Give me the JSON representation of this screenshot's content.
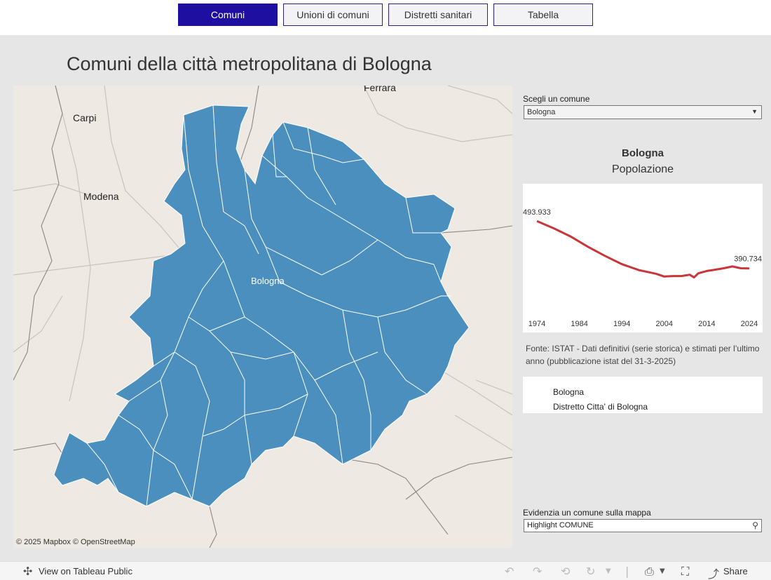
{
  "tabs": [
    "Comuni",
    "Unioni di comuni",
    "Distretti sanitari",
    "Tabella"
  ],
  "title": "Comuni della città metropolitana di Bologna",
  "map": {
    "labels": {
      "ferrara": "Ferrara",
      "carpi": "Carpi",
      "modena": "Modena",
      "bologna": "Bologna"
    },
    "attribution": "© 2025 Mapbox  © OpenStreetMap",
    "fill_color": "#4a8fbd",
    "background": "#efe9e3"
  },
  "selector": {
    "label": "Scegli un comune",
    "value": "Bologna"
  },
  "chart": {
    "name": "Bologna",
    "subtitle": "Popolazione",
    "first_label": "493.933",
    "last_label": "390.734"
  },
  "chart_data": {
    "type": "line",
    "title": "Popolazione",
    "x": [
      1974,
      1978,
      1982,
      1986,
      1990,
      1994,
      1998,
      2000,
      2002,
      2004,
      2006,
      2008,
      2010,
      2011,
      2012,
      2014,
      2016,
      2018,
      2020,
      2022,
      2024
    ],
    "series": [
      {
        "name": "Bologna",
        "values": [
          493933,
          478000,
          460000,
          438000,
          418000,
          400000,
          387000,
          383000,
          379000,
          373000,
          374000,
          374000,
          377000,
          371000,
          380000,
          385000,
          388000,
          391000,
          395000,
          391000,
          390734
        ]
      }
    ],
    "xticks": [
      "1974",
      "1984",
      "1994",
      "2004",
      "2014",
      "2024"
    ],
    "ylim": [
      300000,
      560000
    ],
    "line_color": "#c9363a",
    "grid": false
  },
  "source": "Fonte: ISTAT - Dati definitivi (serie storica) e stimati per l’ultimo anno (pubblicazione istat del 31-3-2025)",
  "info": {
    "comune": "Bologna",
    "distretto": "Distretto Citta' di Bologna"
  },
  "highlight": {
    "label": "Evidenzia un comune sulla mappa",
    "placeholder": "Highlight COMUNE"
  },
  "footer": {
    "view_label": "View on Tableau Public",
    "share_label": "Share"
  }
}
